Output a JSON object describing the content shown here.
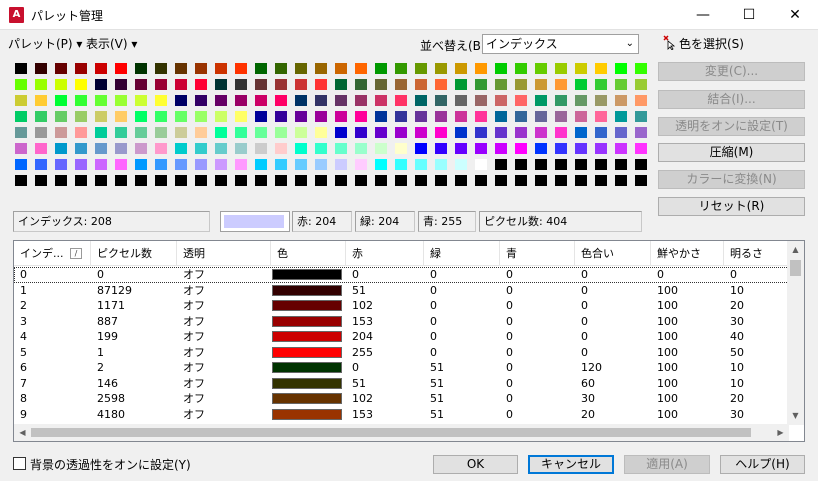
{
  "window": {
    "title": "パレット管理",
    "minimize": "—",
    "maximize": "☐",
    "close": "✕"
  },
  "menu": {
    "palette": "パレット(P) ▾",
    "view": "表示(V) ▾"
  },
  "sort": {
    "label": "並べ替え(B):",
    "value": "インデックス"
  },
  "pick_color": "色を選択(S)",
  "buttons": {
    "change": "変更(C)...",
    "merge": "結合(I)...",
    "transparent_on": "透明をオンに設定(T)",
    "compress": "圧縮(M)",
    "to_color": "カラーに変換(N)",
    "reset": "リセット(R)",
    "ok": "OK",
    "cancel": "キャンセル",
    "apply": "適用(A)",
    "help": "ヘルプ(H)"
  },
  "info": {
    "index": "インデックス:  208",
    "r": "赤: 204",
    "g": "緑: 204",
    "b": "青: 255",
    "pixels": "ピクセル数: 404",
    "selected_color": "#ccccff"
  },
  "table": {
    "headers": [
      "インデ...",
      "ピクセル数",
      "透明",
      "色",
      "赤",
      "緑",
      "青",
      "色合い",
      "鮮やかさ",
      "明るさ"
    ],
    "rows": [
      {
        "idx": "0",
        "px": "0",
        "tr": "オフ",
        "color": "#000000",
        "r": "0",
        "g": "0",
        "b": "0",
        "h": "0",
        "s": "0",
        "v": "0"
      },
      {
        "idx": "1",
        "px": "87129",
        "tr": "オフ",
        "color": "#330000",
        "r": "51",
        "g": "0",
        "b": "0",
        "h": "0",
        "s": "100",
        "v": "10"
      },
      {
        "idx": "2",
        "px": "1171",
        "tr": "オフ",
        "color": "#660000",
        "r": "102",
        "g": "0",
        "b": "0",
        "h": "0",
        "s": "100",
        "v": "20"
      },
      {
        "idx": "3",
        "px": "887",
        "tr": "オフ",
        "color": "#990000",
        "r": "153",
        "g": "0",
        "b": "0",
        "h": "0",
        "s": "100",
        "v": "30"
      },
      {
        "idx": "4",
        "px": "199",
        "tr": "オフ",
        "color": "#cc0000",
        "r": "204",
        "g": "0",
        "b": "0",
        "h": "0",
        "s": "100",
        "v": "40"
      },
      {
        "idx": "5",
        "px": "1",
        "tr": "オフ",
        "color": "#ff0000",
        "r": "255",
        "g": "0",
        "b": "0",
        "h": "0",
        "s": "100",
        "v": "50"
      },
      {
        "idx": "6",
        "px": "2",
        "tr": "オフ",
        "color": "#003300",
        "r": "0",
        "g": "51",
        "b": "0",
        "h": "120",
        "s": "100",
        "v": "10"
      },
      {
        "idx": "7",
        "px": "146",
        "tr": "オフ",
        "color": "#333300",
        "r": "51",
        "g": "51",
        "b": "0",
        "h": "60",
        "s": "100",
        "v": "10"
      },
      {
        "idx": "8",
        "px": "2598",
        "tr": "オフ",
        "color": "#663300",
        "r": "102",
        "g": "51",
        "b": "0",
        "h": "30",
        "s": "100",
        "v": "20"
      },
      {
        "idx": "9",
        "px": "4180",
        "tr": "オフ",
        "color": "#993300",
        "r": "153",
        "g": "51",
        "b": "0",
        "h": "20",
        "s": "100",
        "v": "30"
      }
    ]
  },
  "bg_transparency_label": "背景の透過性をオンに設定(Y)",
  "palette_colors": [
    "#000000",
    "#330000",
    "#660000",
    "#990000",
    "#cc0000",
    "#ff0000",
    "#003300",
    "#333300",
    "#663300",
    "#993300",
    "#cc3300",
    "#ff3300",
    "#006600",
    "#336600",
    "#666600",
    "#996600",
    "#cc6600",
    "#ff6600",
    "#009900",
    "#339900",
    "#669900",
    "#999900",
    "#cc9900",
    "#ff9900",
    "#00cc00",
    "#33cc00",
    "#66cc00",
    "#99cc00",
    "#cccc00",
    "#ffcc00",
    "#00ff00",
    "#33ff00",
    "#66ff00",
    "#99ff00",
    "#ccff00",
    "#ffff00",
    "#000033",
    "#330033",
    "#660033",
    "#990033",
    "#cc0033",
    "#ff0033",
    "#003333",
    "#333333",
    "#663333",
    "#993333",
    "#cc3333",
    "#ff3333",
    "#006633",
    "#336633",
    "#666633",
    "#996633",
    "#cc6633",
    "#ff6633",
    "#009933",
    "#339933",
    "#669933",
    "#999933",
    "#cc9933",
    "#ff9933",
    "#00cc33",
    "#33cc33",
    "#66cc33",
    "#99cc33",
    "#cccc33",
    "#ffcc33",
    "#00ff33",
    "#33ff33",
    "#66ff33",
    "#99ff33",
    "#ccff33",
    "#ffff33",
    "#000066",
    "#330066",
    "#660066",
    "#990066",
    "#cc0066",
    "#ff0066",
    "#003366",
    "#333366",
    "#663366",
    "#993366",
    "#cc3366",
    "#ff3366",
    "#006666",
    "#336666",
    "#666666",
    "#996666",
    "#cc6666",
    "#ff6666",
    "#009966",
    "#339966",
    "#669966",
    "#999966",
    "#cc9966",
    "#ff9966",
    "#00cc66",
    "#33cc66",
    "#66cc66",
    "#99cc66",
    "#cccc66",
    "#ffcc66",
    "#00ff66",
    "#33ff66",
    "#66ff66",
    "#99ff66",
    "#ccff66",
    "#ffff66",
    "#000099",
    "#330099",
    "#660099",
    "#990099",
    "#cc0099",
    "#ff0099",
    "#003399",
    "#333399",
    "#663399",
    "#993399",
    "#cc3399",
    "#ff3399",
    "#006699",
    "#336699",
    "#666699",
    "#996699",
    "#cc6699",
    "#ff6699",
    "#009999",
    "#339999",
    "#669999",
    "#999999",
    "#cc9999",
    "#ff9999",
    "#00cc99",
    "#33cc99",
    "#66cc99",
    "#99cc99",
    "#cccc99",
    "#ffcc99",
    "#00ff99",
    "#33ff99",
    "#66ff99",
    "#99ff99",
    "#ccff99",
    "#ffff99",
    "#0000cc",
    "#3300cc",
    "#6600cc",
    "#9900cc",
    "#cc00cc",
    "#ff00cc",
    "#0033cc",
    "#3333cc",
    "#6633cc",
    "#9933cc",
    "#cc33cc",
    "#ff33cc",
    "#0066cc",
    "#3366cc",
    "#6666cc",
    "#9966cc",
    "#cc66cc",
    "#ff66cc",
    "#0099cc",
    "#3399cc",
    "#6699cc",
    "#9999cc",
    "#cc99cc",
    "#ff99cc",
    "#00cccc",
    "#33cccc",
    "#66cccc",
    "#99cccc",
    "#cccccc",
    "#ffcccc",
    "#00ffcc",
    "#33ffcc",
    "#66ffcc",
    "#99ffcc",
    "#ccffcc",
    "#ffffcc",
    "#0000ff",
    "#3300ff",
    "#6600ff",
    "#9900ff",
    "#cc00ff",
    "#ff00ff",
    "#0033ff",
    "#3333ff",
    "#6633ff",
    "#9933ff",
    "#cc33ff",
    "#ff33ff",
    "#0066ff",
    "#3366ff",
    "#6666ff",
    "#9966ff",
    "#cc66ff",
    "#ff66ff",
    "#0099ff",
    "#3399ff",
    "#6699ff",
    "#9999ff",
    "#cc99ff",
    "#ff99ff",
    "#00ccff",
    "#33ccff",
    "#66ccff",
    "#99ccff",
    "#ccccff",
    "#ffccff",
    "#00ffff",
    "#33ffff",
    "#66ffff",
    "#99ffff",
    "#ccffff",
    "#ffffff",
    "#000000",
    "#000000",
    "#000000",
    "#000000",
    "#000000",
    "#000000",
    "#000000",
    "#000000",
    "#000000",
    "#000000",
    "#000000",
    "#000000",
    "#000000",
    "#000000",
    "#000000",
    "#000000",
    "#000000",
    "#000000",
    "#000000",
    "#000000",
    "#000000",
    "#000000",
    "#000000",
    "#000000",
    "#000000",
    "#000000",
    "#000000",
    "#000000",
    "#000000",
    "#000000",
    "#000000",
    "#000000",
    "#000000",
    "#000000",
    "#000000",
    "#000000",
    "#000000",
    "#000000",
    "#000000",
    "#000000"
  ]
}
